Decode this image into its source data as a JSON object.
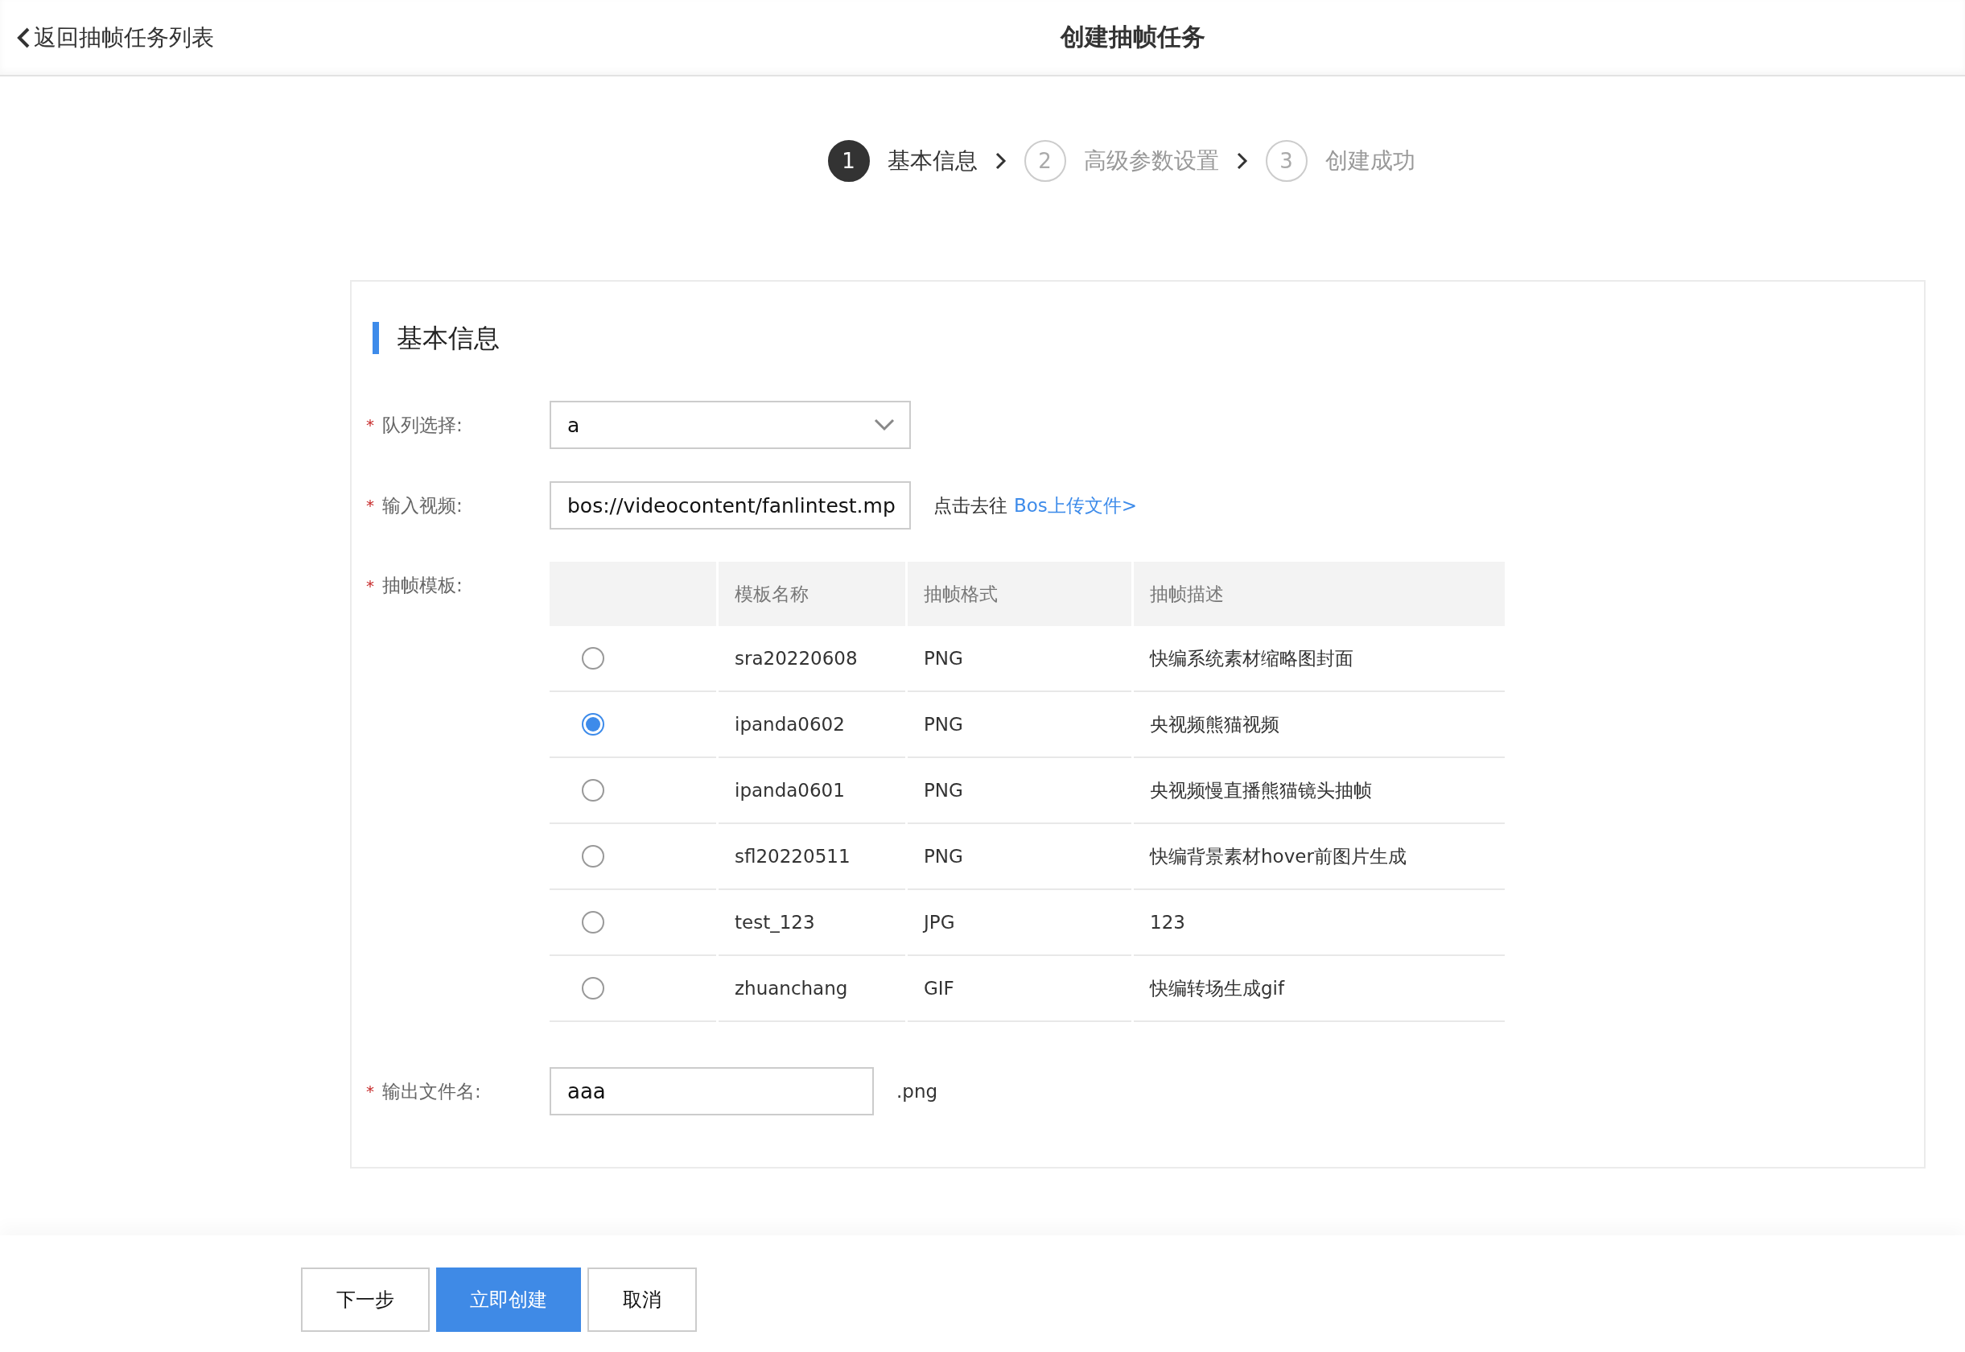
{
  "header": {
    "back_link": "返回抽帧任务列表",
    "title": "创建抽帧任务"
  },
  "steps": [
    {
      "number": "1",
      "label": "基本信息",
      "selected": true
    },
    {
      "number": "2",
      "label": "高级参数设置",
      "selected": false
    },
    {
      "number": "3",
      "label": "创建成功",
      "selected": false
    }
  ],
  "section_title": "基本信息",
  "queue": {
    "marker": "*",
    "label": "队列选择:",
    "value": "a"
  },
  "video": {
    "marker": "*",
    "label": "输入视频:",
    "value": "bos://videocontent/fanlintest.mp",
    "hint": "点击去往",
    "link": "Bos上传文件>"
  },
  "template": {
    "marker": "*",
    "label": "抽帧模板:",
    "columns": [
      "模板名称",
      "抽帧格式",
      "抽帧描述"
    ],
    "rows": [
      {
        "name": "sra20220608",
        "format": "PNG",
        "description": "快编系统素材缩略图封面",
        "selected": false
      },
      {
        "name": "ipanda0602",
        "format": "PNG",
        "description": "央视频熊猫视频",
        "selected": true
      },
      {
        "name": "ipanda0601",
        "format": "PNG",
        "description": "央视频慢直播熊猫镜头抽帧",
        "selected": false
      },
      {
        "name": "sfl20220511",
        "format": "PNG",
        "description": "快编背景素材hover前图片生成",
        "selected": false
      },
      {
        "name": "test_123",
        "format": "JPG",
        "description": "123",
        "selected": false
      },
      {
        "name": "zhuanchang",
        "format": "GIF",
        "description": "快编转场生成gif",
        "selected": false
      }
    ]
  },
  "output": {
    "marker": "*",
    "label": "输出文件名:",
    "value": "aaa",
    "suffix": ".png"
  },
  "buttons": [
    {
      "label": "下一步",
      "kind": "default"
    },
    {
      "label": "立即创建",
      "kind": "primary"
    },
    {
      "label": "取消",
      "kind": "default"
    }
  ]
}
